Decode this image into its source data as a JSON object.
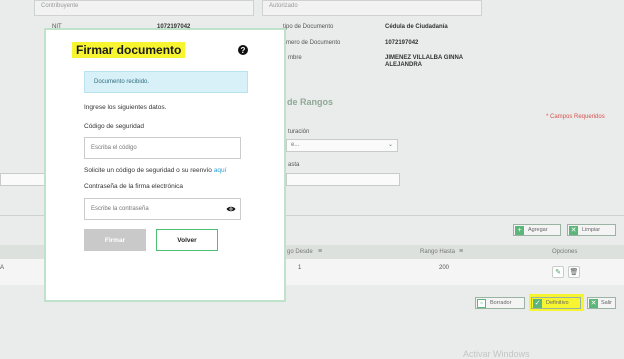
{
  "app": {
    "contribuyente_legend": "Contribuyente",
    "autorizado_legend": "Autorizado",
    "nit_label": "NIT",
    "nit_value": "1072197042",
    "tipo_doc_label": "Tipo de Documento",
    "tipo_doc_label_partial": "tipo de Documento",
    "tipo_doc_value": "Cédula de Ciudadanía",
    "num_doc_label_partial": "mero de Documento",
    "num_doc_value": "1072197042",
    "nombre_label_partial": "mbre",
    "nombre_value": "JIMENEZ VILLALBA GINNA ALEJANDRA",
    "section_title_partial": "de Rangos",
    "required_note": "* Campos Requeridos",
    "facturacion_label_partial": "turación",
    "facturacion_select_partial": "e...",
    "hasta_label_partial": "asta",
    "agregar_label": "Agregar",
    "limpiar_label": "Limpiar",
    "table_headers": {
      "rango_desde_partial": "go Desde",
      "rango_hasta": "Rango Hasta",
      "opciones": "Opciones"
    },
    "row": {
      "left_partial": "A",
      "desde": "1",
      "hasta": "200"
    },
    "borrador_label": "Borrador",
    "definitivo_label": "Definitivo",
    "salir_label": "Salir",
    "watermark": "Activar Windows"
  },
  "modal": {
    "title": "Firmar documento",
    "help_icon": "question-icon",
    "alert_text": "Documento recibido.",
    "instruction": "Ingrese los siguientes datos.",
    "codigo_label": "Código de seguridad",
    "codigo_placeholder": "Escriba el código",
    "solicite_text": "Solicite un código de seguridad o su reenvío",
    "aqui_link": "aquí",
    "password_label": "Contraseña de la firma electrónica",
    "password_placeholder": "Escribe la contraseña",
    "firmar_label": "Firmar",
    "volver_label": "Volver"
  },
  "colors": {
    "accent_green": "#4bbf74",
    "highlight": "#f7f430",
    "alert_bg": "#d8f1f8",
    "link": "#2d9fd8"
  }
}
